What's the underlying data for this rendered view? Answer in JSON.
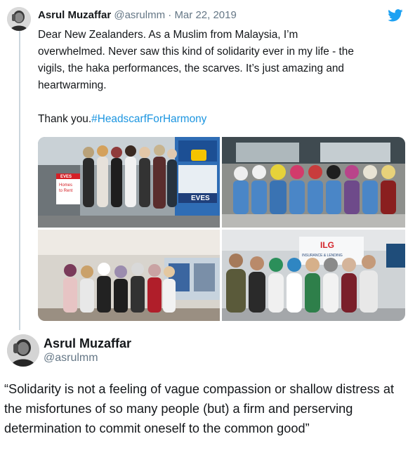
{
  "tweet1": {
    "author_name": "Asrul Muzaffar",
    "author_handle": "@asrulmm",
    "separator": "·",
    "date": "Mar 22, 2019",
    "text_lines": [
      "Dear New Zealanders. As a Muslim from Malaysia, I’m",
      "overwhelmed. Never saw this kind of solidarity ever in my life - the",
      "vigils, the haka performances, the scarves. It’s just amazing and",
      "heartwarming."
    ],
    "thanks": "Thank you.",
    "hashtag": "#HeadscarfForHarmony",
    "photo1_signs": {
      "eves": "EVES",
      "eves_small": "EVES",
      "sign_line1": "Homes",
      "sign_line2": "to Rent"
    },
    "photo4_sign": {
      "logo": "ILG",
      "line1": "INSURANCE & LENDING"
    },
    "icons": {
      "brand": "twitter-bird-icon"
    },
    "colors": {
      "link": "#1b95e0",
      "secondary": "#657786"
    }
  },
  "tweet2": {
    "author_name": "Asrul Muzaffar",
    "author_handle": "@asrulmm",
    "quote": "“Solidarity is not a feeling of vague compassion or shallow distress at the misfortunes of so many people (but) a firm and perserving determination to commit oneself to the common good”"
  }
}
